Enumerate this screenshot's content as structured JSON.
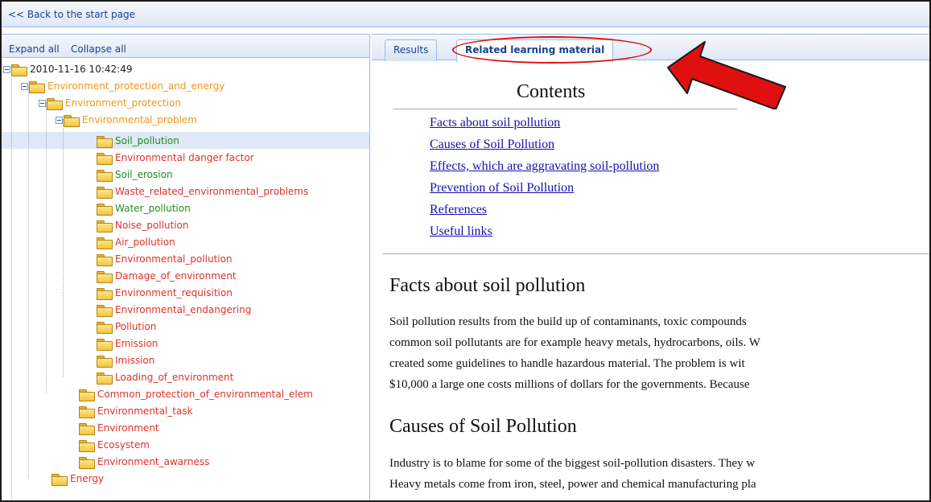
{
  "topbar": {
    "back_label": "<< Back to the start page"
  },
  "left_panel": {
    "expand_all": "Expand all",
    "collapse_all": "Collapse all",
    "root": "2010-11-16 10:42:49",
    "level1": "Environment_protection_and_energy",
    "level2": "Environment_protection",
    "level3": "Environmental_problem",
    "problem_items": [
      "Soil_pollution",
      "Environmental danger factor",
      "Soil_erosion",
      "Waste_related_environmental_problems",
      "Water_pollution",
      "Noise_pollution",
      "Air_pollution",
      "Environmental_pollution",
      "Damage_of_environment",
      "Environment_requisition",
      "Environmental_endangering",
      "Pollution",
      "Emission",
      "Imission",
      "Loading_of_environment"
    ],
    "protection_items": [
      "Common_protection_of_environmental_elem",
      "Environmental_task",
      "Environment",
      "Ecosystem",
      "Environment_awarness"
    ],
    "energy": "Energy"
  },
  "tabs": [
    {
      "label": "Results"
    },
    {
      "label": "Related learning material"
    }
  ],
  "content": {
    "contents_title": "Contents",
    "toc": [
      "Facts about soil pollution",
      "Causes of Soil Pollution",
      "Effects, which are aggravating soil-pollution",
      "Prevention of Soil Pollution",
      "References",
      "Useful links"
    ],
    "section1_title": "Facts about soil pollution",
    "section1_lines": [
      "Soil pollution results from the build up of contaminants, toxic compounds",
      "common soil pollutants are for example heavy metals, hydrocarbons, oils. W",
      "created some guidelines to handle hazardous material. The problem is wit",
      "$10,000 a large one costs millions of dollars for the governments. Because"
    ],
    "section2_title": "Causes of Soil Pollution",
    "section2_lines": [
      "Industry is to blame for some of the biggest soil-pollution disasters. They w",
      "Heavy metals come from iron, steel, power and chemical manufacturing pla"
    ]
  },
  "colors": {
    "accent_blue": "#15428b",
    "border_blue": "#99bbe8",
    "selected_bg": "#dfe8f6",
    "annotation_red": "#e01010"
  }
}
